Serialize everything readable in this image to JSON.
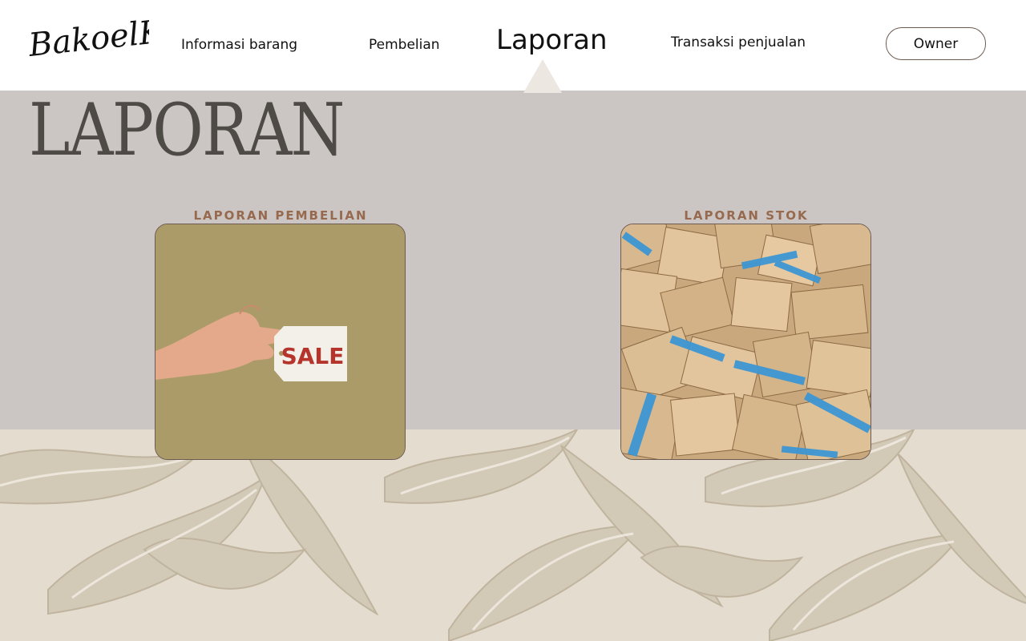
{
  "brand": {
    "logo_text": "BakoelKaos"
  },
  "nav": {
    "items": [
      {
        "label": "Informasi barang"
      },
      {
        "label": "Pembelian"
      },
      {
        "label": "Laporan",
        "active": true
      },
      {
        "label": "Transaksi penjualan"
      }
    ]
  },
  "user": {
    "role_label": "Owner"
  },
  "page": {
    "title": "LAPORAN"
  },
  "cards": [
    {
      "label": "LAPORAN PEMBELIAN",
      "image_text": "SALE",
      "icon": "sale-tag-image"
    },
    {
      "label": "LAPORAN STOK",
      "icon": "cardboard-boxes-image"
    }
  ],
  "colors": {
    "header_bg": "#ffffff",
    "content_bg": "#cbc6c3",
    "title": "#4e4a46",
    "card_label": "#97694e",
    "card_border": "#6d5b52",
    "sale_text": "#b5352c"
  }
}
